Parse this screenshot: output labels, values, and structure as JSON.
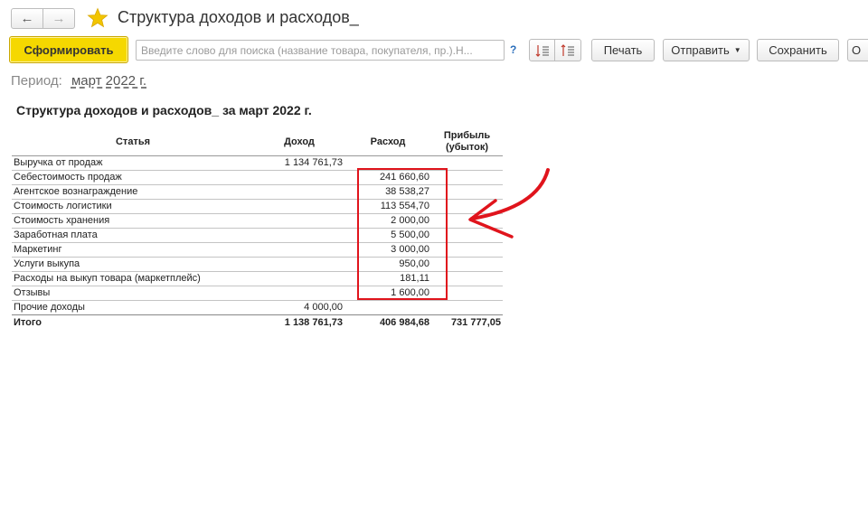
{
  "window": {
    "title": "Структура доходов и расходов_",
    "back_icon": "←",
    "forward_icon": "→"
  },
  "toolbar": {
    "generate_label": "Сформировать",
    "search_placeholder": "Введите слово для поиска (название товара, покупателя, пр.).Н...",
    "help_label": "?",
    "print_label": "Печать",
    "send_label": "Отправить",
    "save_label": "Сохранить",
    "more_label": "О"
  },
  "period": {
    "label": "Период:",
    "value": "март 2022 г."
  },
  "report": {
    "title": "Структура доходов и расходов_ за март 2022 г.",
    "columns": {
      "name": "Статья",
      "income": "Доход",
      "expense": "Расход",
      "profit": "Прибыль (убыток)"
    },
    "rows": [
      {
        "name": "Выручка от продаж",
        "income": "1 134 761,73",
        "expense": "",
        "profit": ""
      },
      {
        "name": "Себестоимость продаж",
        "income": "",
        "expense": "241 660,60",
        "profit": ""
      },
      {
        "name": "Агентское вознаграждение",
        "income": "",
        "expense": "38 538,27",
        "profit": ""
      },
      {
        "name": "Стоимость логистики",
        "income": "",
        "expense": "113 554,70",
        "profit": ""
      },
      {
        "name": "Стоимость хранения",
        "income": "",
        "expense": "2 000,00",
        "profit": ""
      },
      {
        "name": "Заработная плата",
        "income": "",
        "expense": "5 500,00",
        "profit": ""
      },
      {
        "name": "Маркетинг",
        "income": "",
        "expense": "3 000,00",
        "profit": ""
      },
      {
        "name": "Услуги выкупа",
        "income": "",
        "expense": "950,00",
        "profit": ""
      },
      {
        "name": "Расходы на выкуп товара (маркетплейс)",
        "income": "",
        "expense": "181,11",
        "profit": ""
      },
      {
        "name": "Отзывы",
        "income": "",
        "expense": "1 600,00",
        "profit": ""
      },
      {
        "name": "Прочие доходы",
        "income": "4 000,00",
        "expense": "",
        "profit": ""
      }
    ],
    "total": {
      "name": "Итого",
      "income": "1 138 761,73",
      "expense": "406 984,68",
      "profit": "731 777,05"
    }
  },
  "colors": {
    "primary_button": "#f5d800",
    "annotation": "#e0141c",
    "star": "#f2c500"
  }
}
